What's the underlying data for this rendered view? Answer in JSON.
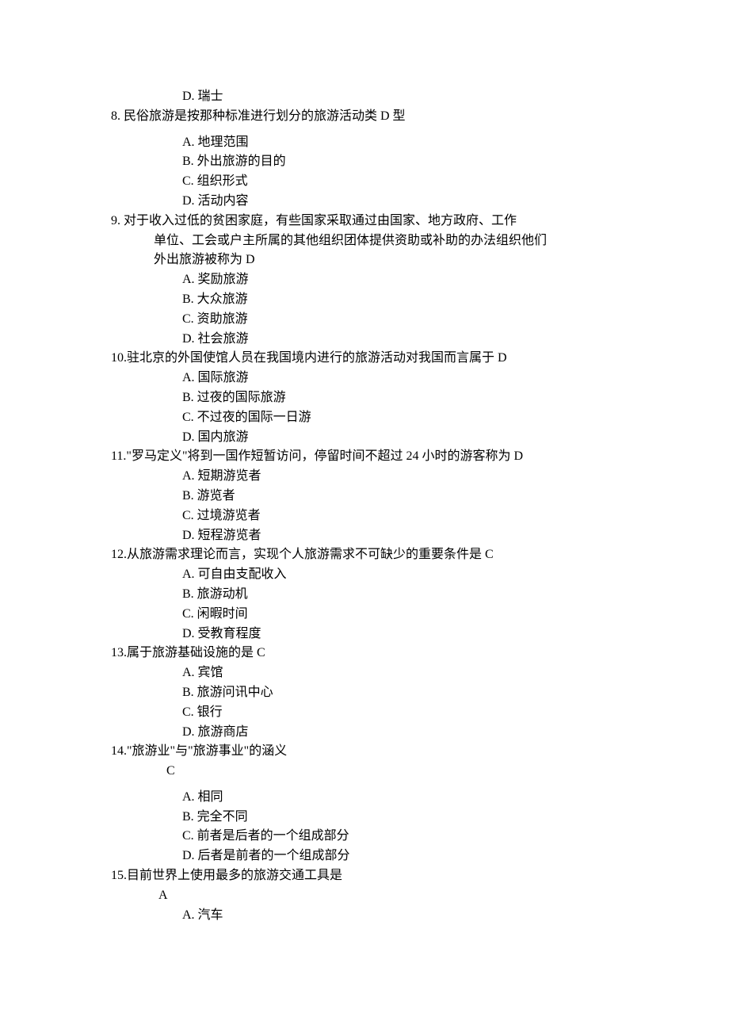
{
  "q7_optD": "D. 瑞士",
  "q8_stem": "8. 民俗旅游是按那种标准进行划分的旅游活动类 D 型",
  "q8_A": "A. 地理范围",
  "q8_B": "B. 外出旅游的目的",
  "q8_C": "C. 组织形式",
  "q8_D": "D. 活动内容",
  "q9_stem1": "9. 对于收入过低的贫困家庭，有些国家采取通过由国家、地方政府、工作",
  "q9_stem2": "单位、工会或户主所属的其他组织团体提供资助或补助的办法组织他们",
  "q9_stem3": "外出旅游被称为   D",
  "q9_A": "A. 奖励旅游",
  "q9_B": "B. 大众旅游",
  "q9_C": "C.    资助旅游",
  "q9_D": "D. 社会旅游",
  "q10_stem": "10.驻北京的外国使馆人员在我国境内进行的旅游活动对我国而言属于 D",
  "q10_A": "A. 国际旅游",
  "q10_B": "B. 过夜的国际旅游",
  "q10_C": "C. 不过夜的国际一日游",
  "q10_D": "D. 国内旅游",
  "q11_stem": "11.\"罗马定义\"将到一国作短暂访问，停留时间不超过 24 小时的游客称为  D",
  "q11_A": "A. 短期游览者",
  "q11_B": "B. 游览者",
  "q11_C": "C. 过境游览者",
  "q11_D": "D. 短程游览者",
  "q12_stem": "12.从旅游需求理论而言，实现个人旅游需求不可缺少的重要条件是 C",
  "q12_A": "A. 可自由支配收入",
  "q12_B": "B. 旅游动机",
  "q12_C": "C. 闲暇时间",
  "q12_D": "D. 受教育程度",
  "q13_stem": "13.属于旅游基础设施的是 C",
  "q13_A": "A. 宾馆",
  "q13_B": "B. 旅游问讯中心",
  "q13_C": "C. 银行",
  "q13_D": "D. 旅游商店",
  "q14_stem": "14.\"旅游业\"与\"旅游事业\"的涵义",
  "q14_ans": " C",
  "q14_A": "A. 相同",
  "q14_B": "B. 完全不同",
  "q14_C": "C. 前者是后者的一个组成部分",
  "q14_D": "D. 后者是前者的一个组成部分",
  "q15_stem": "15.目前世界上使用最多的旅游交通工具是",
  "q15_ans": "A",
  "q15_A": "A. 汽车"
}
